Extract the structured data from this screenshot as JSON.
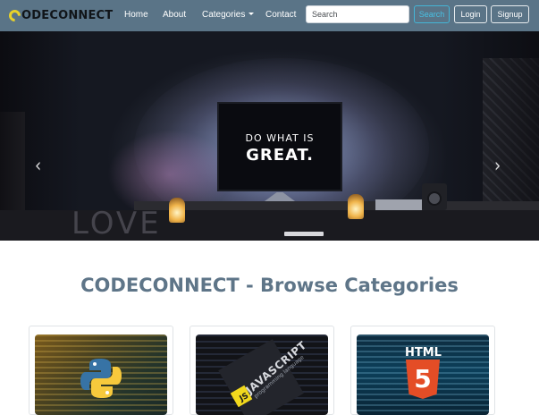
{
  "navbar": {
    "brand_text": "ODECONNECT",
    "links": {
      "home": "Home",
      "about": "About",
      "categories": "Categories",
      "contact": "Contact"
    },
    "search_placeholder": "Search",
    "search_button": "Search",
    "login_button": "Login",
    "signup_button": "Signup"
  },
  "hero": {
    "screen_line_1": "DO WHAT IS",
    "screen_line_2": "GREAT.",
    "wall_text": "LOVE",
    "prev_glyph": "‹",
    "next_glyph": "›",
    "slide_count": 3,
    "active_slide": 1
  },
  "main": {
    "title": "CODECONNECT - Browse Categories",
    "cards": [
      {
        "image": "python-logo"
      },
      {
        "image": "javascript-book",
        "cover_title": "JAVASCRIPT",
        "cover_subtitle": "programming language",
        "badge": "JS"
      },
      {
        "image": "html5-logo",
        "heading": "HTML",
        "number": "5"
      }
    ]
  },
  "colors": {
    "navbar": "#5a7487",
    "brand_accent": "#e9d22a",
    "search_button": "#48c0e3",
    "title": "#5e7588"
  }
}
